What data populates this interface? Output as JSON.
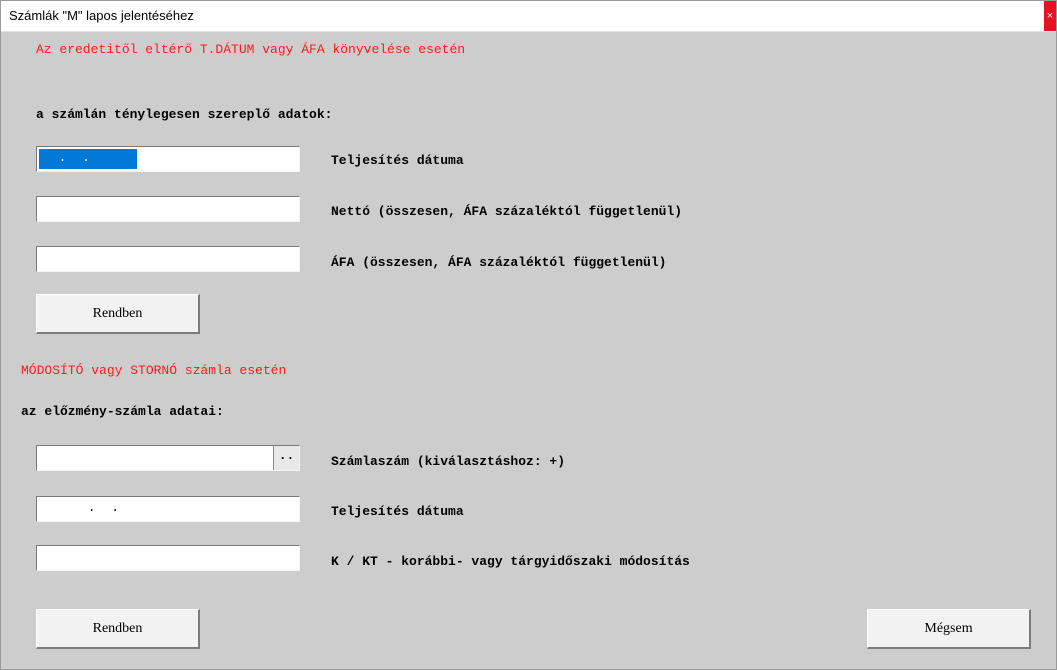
{
  "window": {
    "title": "Számlák \"M\" lapos jelentéséhez",
    "close_label": "×"
  },
  "section1": {
    "heading": "Az eredetitől eltérő T.DÁTUM vagy ÁFA könyvelése esetén",
    "subheading": "a számlán ténylegesen szereplő adatok:",
    "fields": [
      {
        "value": "  .  .  ",
        "label": "Teljesítés dátuma"
      },
      {
        "value": "",
        "label": "Nettó (összesen, ÁFA százaléktól függetlenül)"
      },
      {
        "value": "",
        "label": "ÁFA (összesen, ÁFA százaléktól függetlenül)"
      }
    ],
    "ok_label": "Rendben"
  },
  "section2": {
    "heading": "MÓDOSÍTÓ vagy STORNÓ számla esetén",
    "subheading": "az előzmény-számla adatai:",
    "fields": [
      {
        "value": "",
        "label": "Számlaszám (kiválasztáshoz: +)",
        "button": ".."
      },
      {
        "value": "      .  .",
        "label": "Teljesítés dátuma"
      },
      {
        "value": "",
        "label": "K / KT - korábbi- vagy tárgyidőszaki módosítás"
      }
    ],
    "ok_label": "Rendben"
  },
  "cancel_label": "Mégsem",
  "colors": {
    "heading_red": "#ff1a1a",
    "selection_blue": "#0078d7",
    "dialog_bg": "#cdcdcd"
  }
}
